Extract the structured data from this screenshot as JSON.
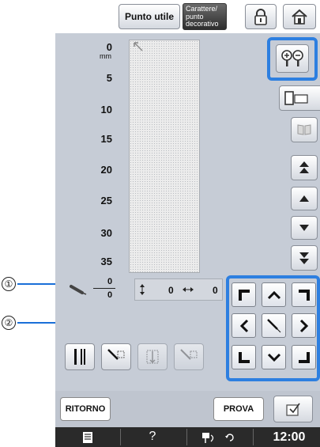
{
  "tabs": {
    "utility": "Punto utile",
    "character_l1": "Carattere/",
    "character_l2": "punto",
    "character_l3": "decorativo"
  },
  "ruler": {
    "unit": "mm",
    "ticks": [
      "0",
      "5",
      "10",
      "15",
      "20",
      "25",
      "30",
      "35"
    ]
  },
  "readout": {
    "numerator": "0",
    "denominator": "0",
    "vertical_value": "0",
    "horizontal_value": "0"
  },
  "callouts": [
    "①",
    "②"
  ],
  "footer": {
    "back_label": "RITORNO",
    "test_label": "PROVA",
    "time": "12:00",
    "help": "?"
  },
  "colors": {
    "accent": "#2d7fe0",
    "screen_bg": "#c6ccd6",
    "status_bar": "#2a2a2a"
  },
  "icons": [
    "lock-icon",
    "home-icon",
    "zoom-icon",
    "display-toggle-icon",
    "mirror-icon",
    "jump-up-icon",
    "step-up-icon",
    "step-down-icon",
    "jump-down-icon",
    "needle-icon",
    "settings-icon",
    "thread-icon",
    "rotate-icon"
  ]
}
